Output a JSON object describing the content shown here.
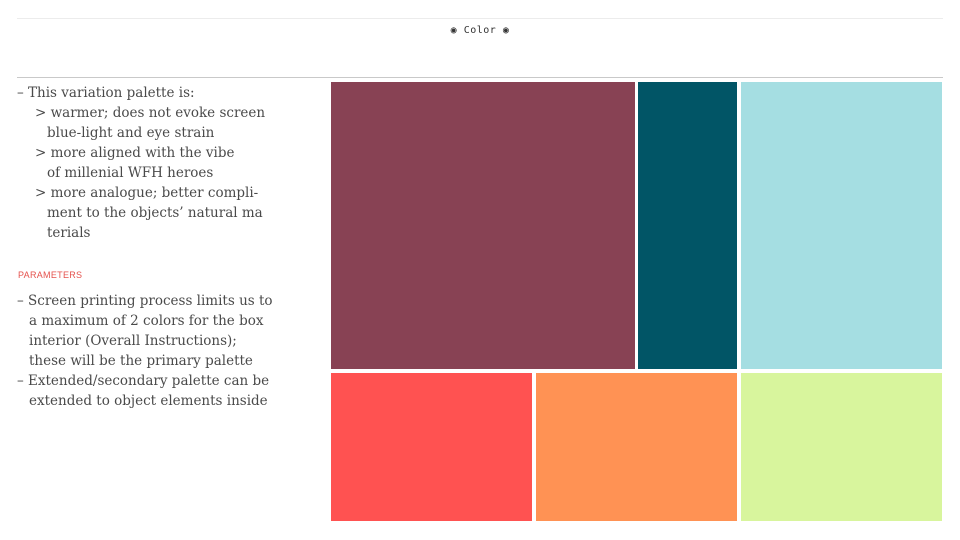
{
  "header": {
    "title": "◉ Color ◉"
  },
  "notes": {
    "lines": [
      "– This variation palette is:",
      "> warmer; does not evoke screen",
      "blue-light and eye strain",
      "> more aligned with the vibe",
      "of millenial WFH heroes",
      "> more analogue; better compli-",
      "ment to the objects’ natural ma",
      "terials"
    ]
  },
  "parameters": {
    "heading": "PARAMETERS",
    "lines": [
      "– Screen printing process limits us to",
      "a maximum of 2 colors for the box",
      "interior (Overall Instructions);",
      "these will be the primary palette",
      "– Extended/secondary palette can be",
      "extended to object elements inside"
    ]
  },
  "palette": {
    "plum": "#884254",
    "teal": "#015566",
    "light_blue": "#a5dee2",
    "coral": "#ff5251",
    "orange": "#ff9254",
    "lime": "#d8f59d"
  }
}
